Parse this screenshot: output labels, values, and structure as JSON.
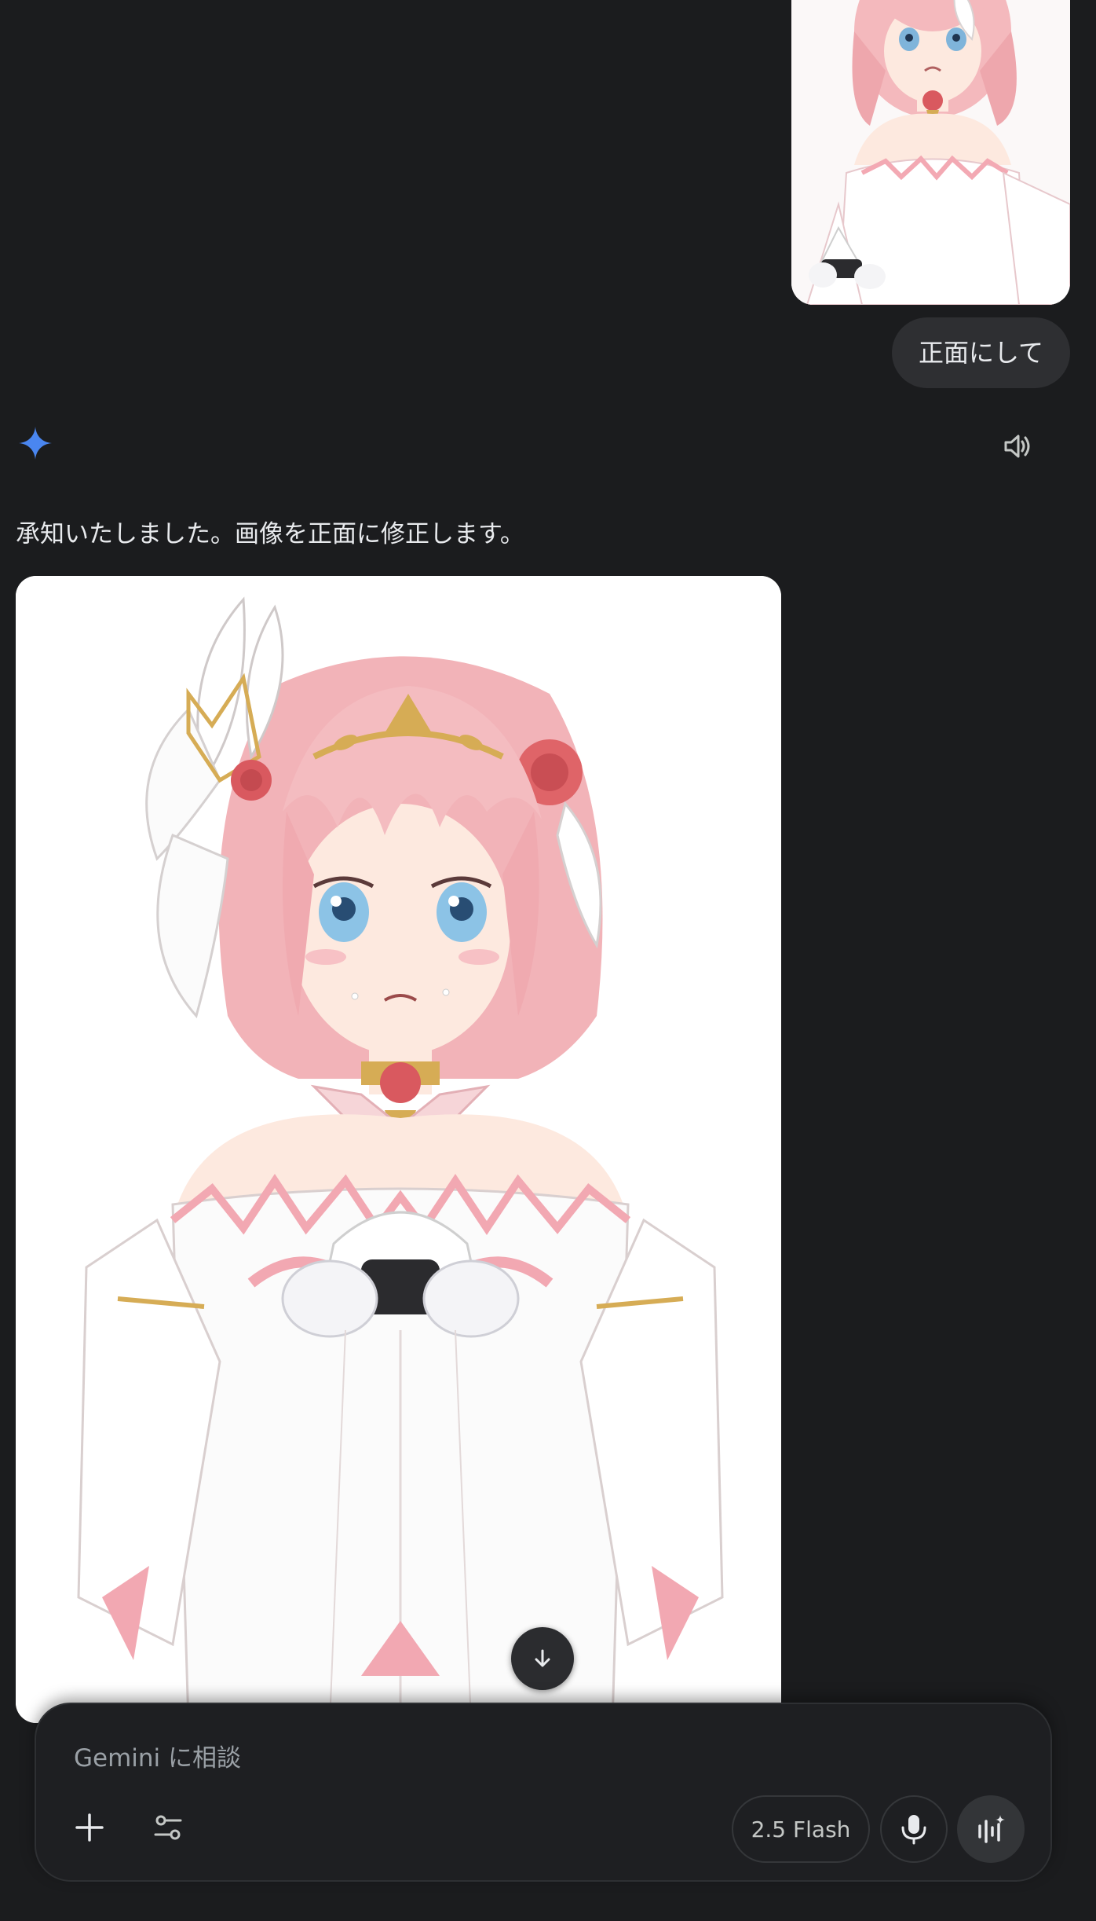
{
  "conversation": {
    "user_message": {
      "image_icon": "anime-character-image",
      "text": "正面にして"
    },
    "model_response": {
      "avatar_icon": "gemini-spark-icon",
      "read_aloud_icon": "speaker-icon",
      "text": "承知いたしました。画像を正面に修正します。",
      "image_icon": "anime-character-image"
    }
  },
  "scroll_down_icon": "arrow-down-icon",
  "composer": {
    "placeholder": "Gemini に相談",
    "add_icon": "plus-icon",
    "tools_icon": "tune-icon",
    "model_label": "2.5 Flash",
    "mic_icon": "mic-icon",
    "live_icon": "live-waveform-icon"
  },
  "colors": {
    "background": "#1b1c1e",
    "bubble": "#2e2f32",
    "spark": "#4a86f0",
    "text": "#e8eaed",
    "placeholder": "#9aa0a6"
  }
}
